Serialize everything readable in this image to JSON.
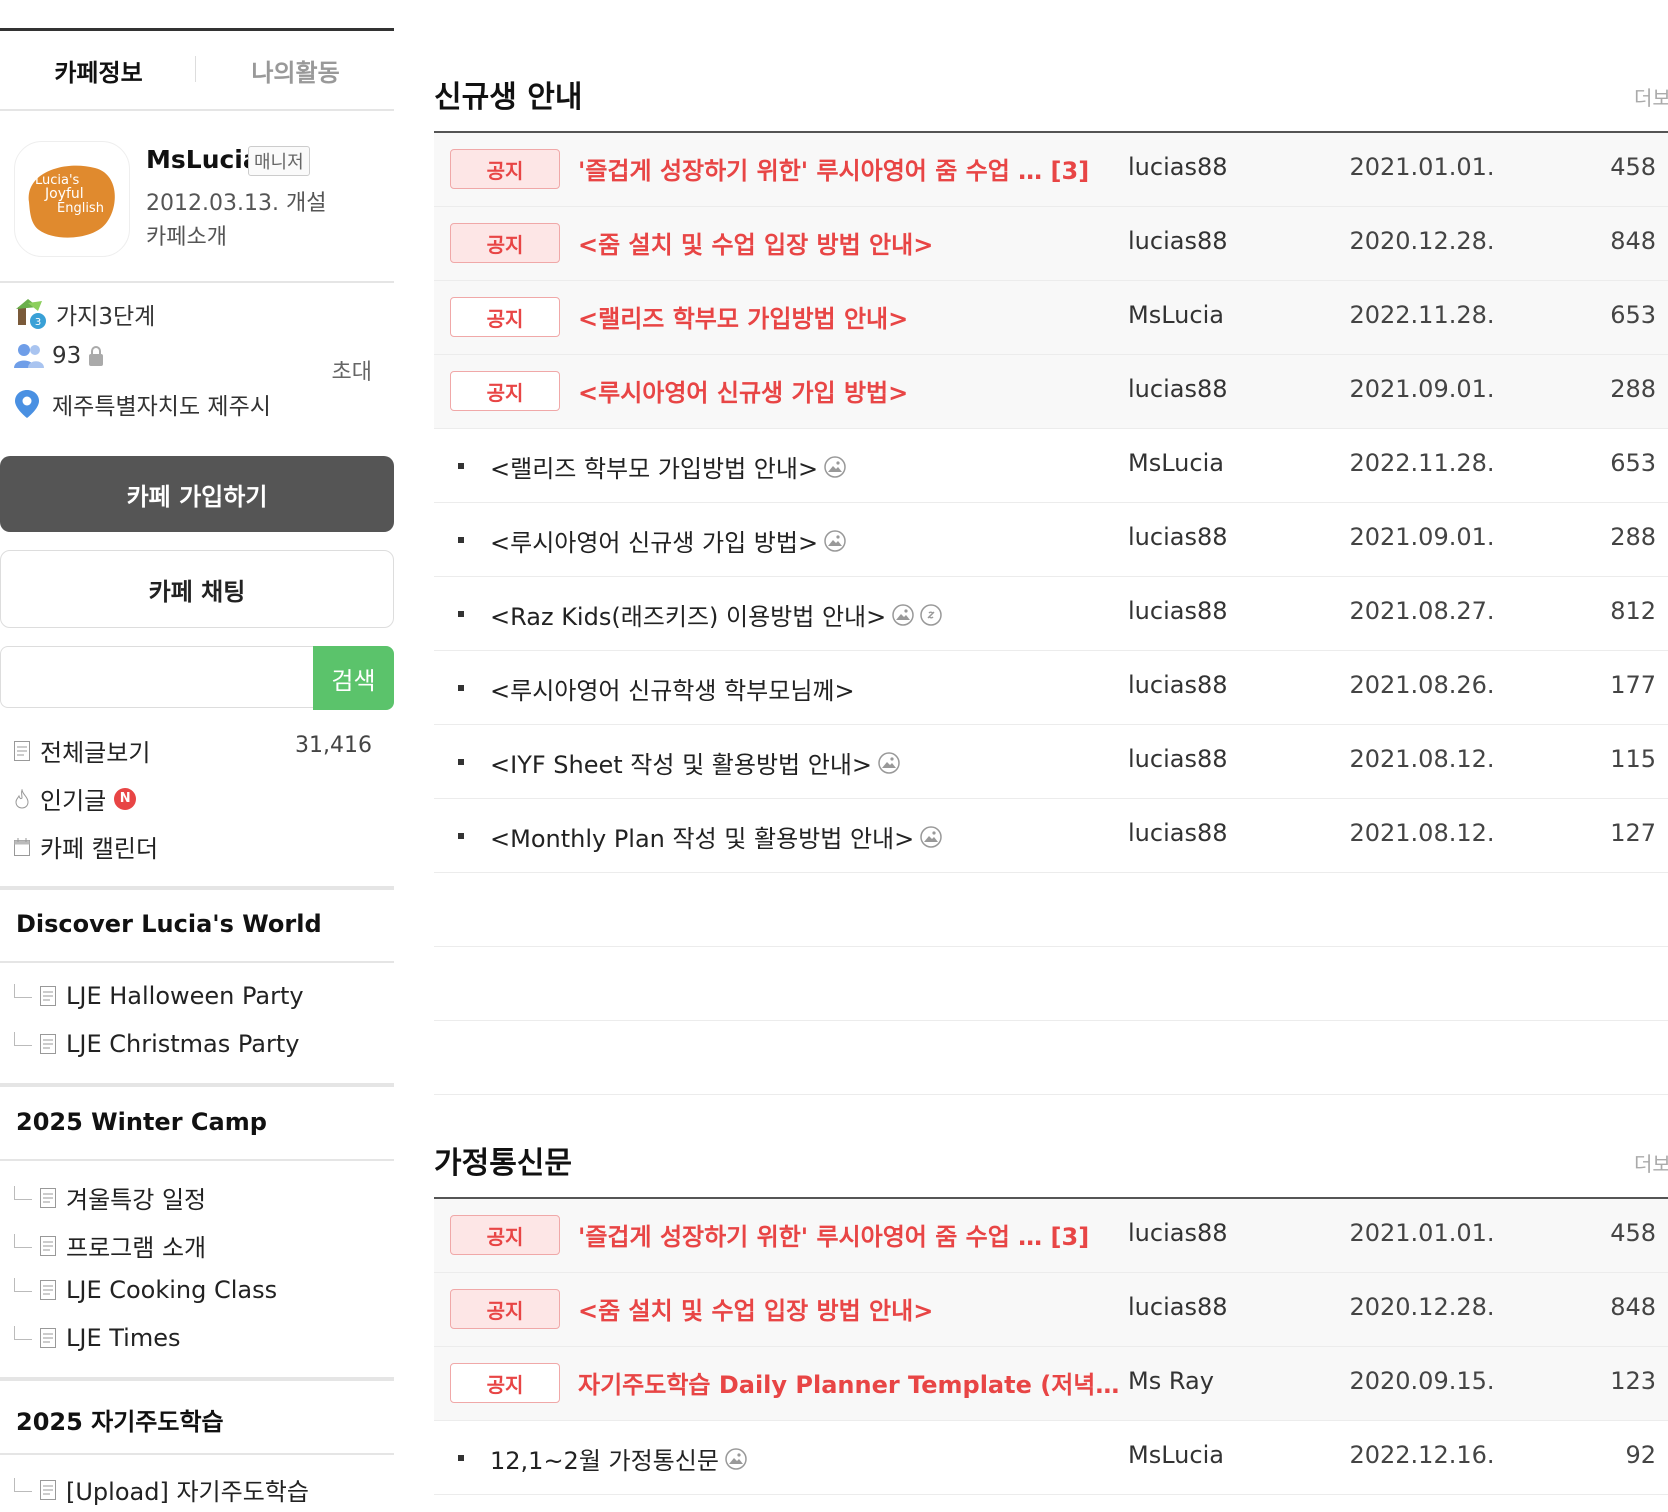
{
  "sidebar": {
    "tabs": [
      "카페정보",
      "나의활동"
    ],
    "manager": {
      "name": "MsLucia",
      "badge": "매니저",
      "established": "2012.03.13. 개설",
      "intro_link": "카페소개"
    },
    "logo_text": {
      "line1": "Lucia's",
      "line2": "Joyful",
      "line3": "English"
    },
    "level": "가지3단계",
    "members": "93",
    "invite": "초대",
    "location": "제주특별자치도 제주시",
    "join_button": "카페 가입하기",
    "chat_button": "카페 채팅",
    "search": {
      "placeholder": "",
      "button": "검색"
    },
    "menu": [
      {
        "label": "전체글보기",
        "count": "31,416"
      },
      {
        "label": "인기글",
        "badge": "N"
      },
      {
        "label": "카페 캘린더"
      }
    ],
    "groups": [
      {
        "title": "Discover Lucia's World",
        "items": [
          "LJE Halloween Party",
          "LJE Christmas Party"
        ]
      },
      {
        "title": "2025 Winter Camp",
        "items": [
          "겨울특강 일정",
          "프로그램 소개",
          "LJE Cooking Class",
          "LJE Times"
        ]
      },
      {
        "title": "2025 자기주도학습",
        "items": [
          "[Upload] 자기주도학습"
        ]
      }
    ]
  },
  "boards": [
    {
      "title": "신규생 안내",
      "more": "더보기",
      "notices": [
        {
          "badge": "공지",
          "title": "'즐겁게 성장하기 위한' 루시아영어 줌 수업 …",
          "comments": "[3]",
          "author": "lucias88",
          "date": "2021.01.01.",
          "views": "458"
        },
        {
          "badge": "공지",
          "title": "<줌 설치 및 수업 입장 방법 안내>",
          "comments": "",
          "author": "lucias88",
          "date": "2020.12.28.",
          "views": "848"
        },
        {
          "badge": "공지",
          "title": "<랠리즈 학부모 가입방법 안내>",
          "comments": "",
          "author": "MsLucia",
          "date": "2022.11.28.",
          "views": "653"
        },
        {
          "badge": "공지",
          "title": "<루시아영어 신규생 가입 방법>",
          "comments": "",
          "author": "lucias88",
          "date": "2021.09.01.",
          "views": "288"
        }
      ],
      "posts": [
        {
          "title": "<랠리즈 학부모 가입방법 안내>",
          "author": "MsLucia",
          "date": "2022.11.28.",
          "views": "653"
        },
        {
          "title": "<루시아영어 신규생 가입 방법>",
          "author": "lucias88",
          "date": "2021.09.01.",
          "views": "288"
        },
        {
          "title": "<Raz Kids(래즈키즈) 이용방법 안내>",
          "author": "lucias88",
          "date": "2021.08.27.",
          "views": "812"
        },
        {
          "title": "<루시아영어 신규학생 학부모님께>",
          "author": "lucias88",
          "date": "2021.08.26.",
          "views": "177"
        },
        {
          "title": "<IYF Sheet 작성 및 활용방법 안내>",
          "author": "lucias88",
          "date": "2021.08.12.",
          "views": "115"
        },
        {
          "title": "<Monthly Plan 작성 및 활용방법 안내>",
          "author": "lucias88",
          "date": "2021.08.12.",
          "views": "127"
        }
      ]
    },
    {
      "title": "가정통신문",
      "more": "더보기",
      "notices": [
        {
          "badge": "공지",
          "title": "'즐겁게 성장하기 위한' 루시아영어 줌 수업 …",
          "comments": "[3]",
          "author": "lucias88",
          "date": "2021.01.01.",
          "views": "458"
        },
        {
          "badge": "공지",
          "title": "<줌 설치 및 수업 입장 방법 안내>",
          "comments": "",
          "author": "lucias88",
          "date": "2020.12.28.",
          "views": "848"
        },
        {
          "badge": "공지",
          "title": "자기주도학습 Daily Planner Template (저녁…",
          "comments": "",
          "author": "Ms Ray",
          "date": "2020.09.15.",
          "views": "123"
        }
      ],
      "posts": [
        {
          "title": "12,1~2월 가정통신문",
          "author": "MsLucia",
          "date": "2022.12.16.",
          "views": "92"
        }
      ]
    }
  ],
  "colors": {
    "accent_red": "#e84545",
    "search_green": "#5bc36b",
    "join_gray": "#555555"
  },
  "icons": [
    "photo-icon",
    "link-icon",
    "document-icon",
    "fire-icon",
    "calendar-icon",
    "members-icon",
    "lock-icon",
    "location-pin-icon",
    "level-icon"
  ]
}
